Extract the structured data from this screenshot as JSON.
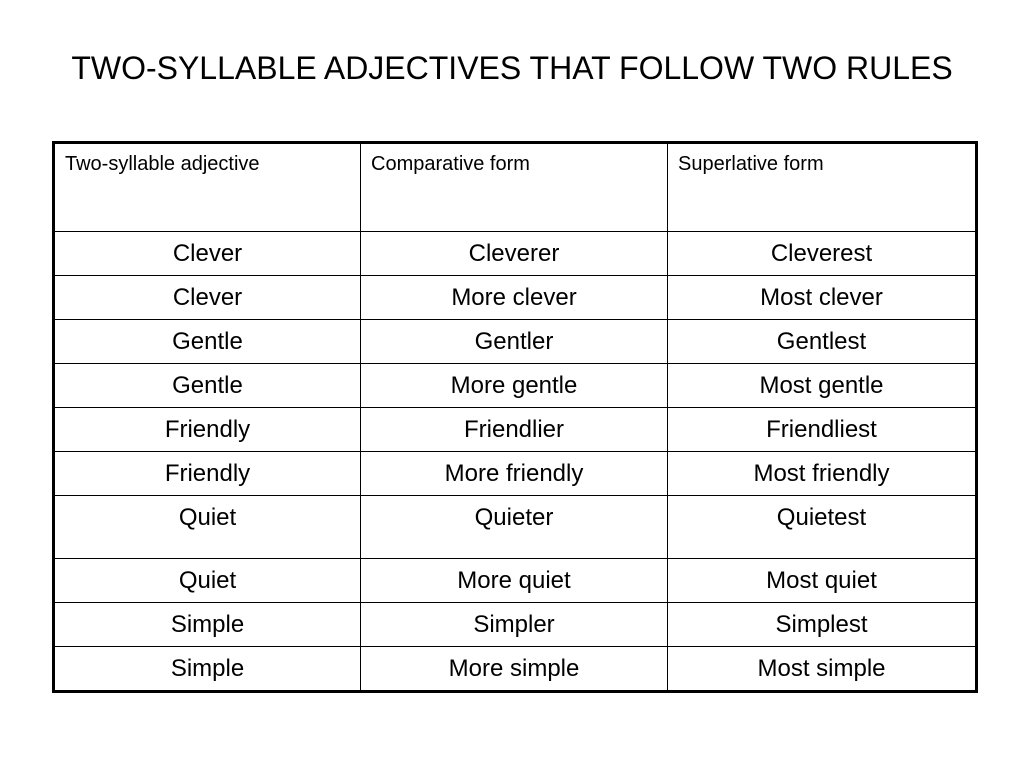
{
  "title": "TWO-SYLLABLE ADJECTIVES THAT FOLLOW TWO RULES",
  "table": {
    "headers": [
      "Two-syllable adjective",
      "Comparative form",
      "Superlative form"
    ],
    "rows": [
      [
        "Clever",
        "Cleverer",
        "Cleverest"
      ],
      [
        "Clever",
        "More clever",
        "Most clever"
      ],
      [
        "Gentle",
        "Gentler",
        "Gentlest"
      ],
      [
        "Gentle",
        "More gentle",
        "Most gentle"
      ],
      [
        "Friendly",
        "Friendlier",
        "Friendliest"
      ],
      [
        "Friendly",
        "More friendly",
        "Most friendly"
      ],
      [
        "Quiet",
        "Quieter",
        "Quietest"
      ],
      [
        "Quiet",
        "More quiet",
        "Most quiet"
      ],
      [
        "Simple",
        "Simpler",
        "Simplest"
      ],
      [
        "Simple",
        "More simple",
        "Most simple"
      ]
    ]
  }
}
